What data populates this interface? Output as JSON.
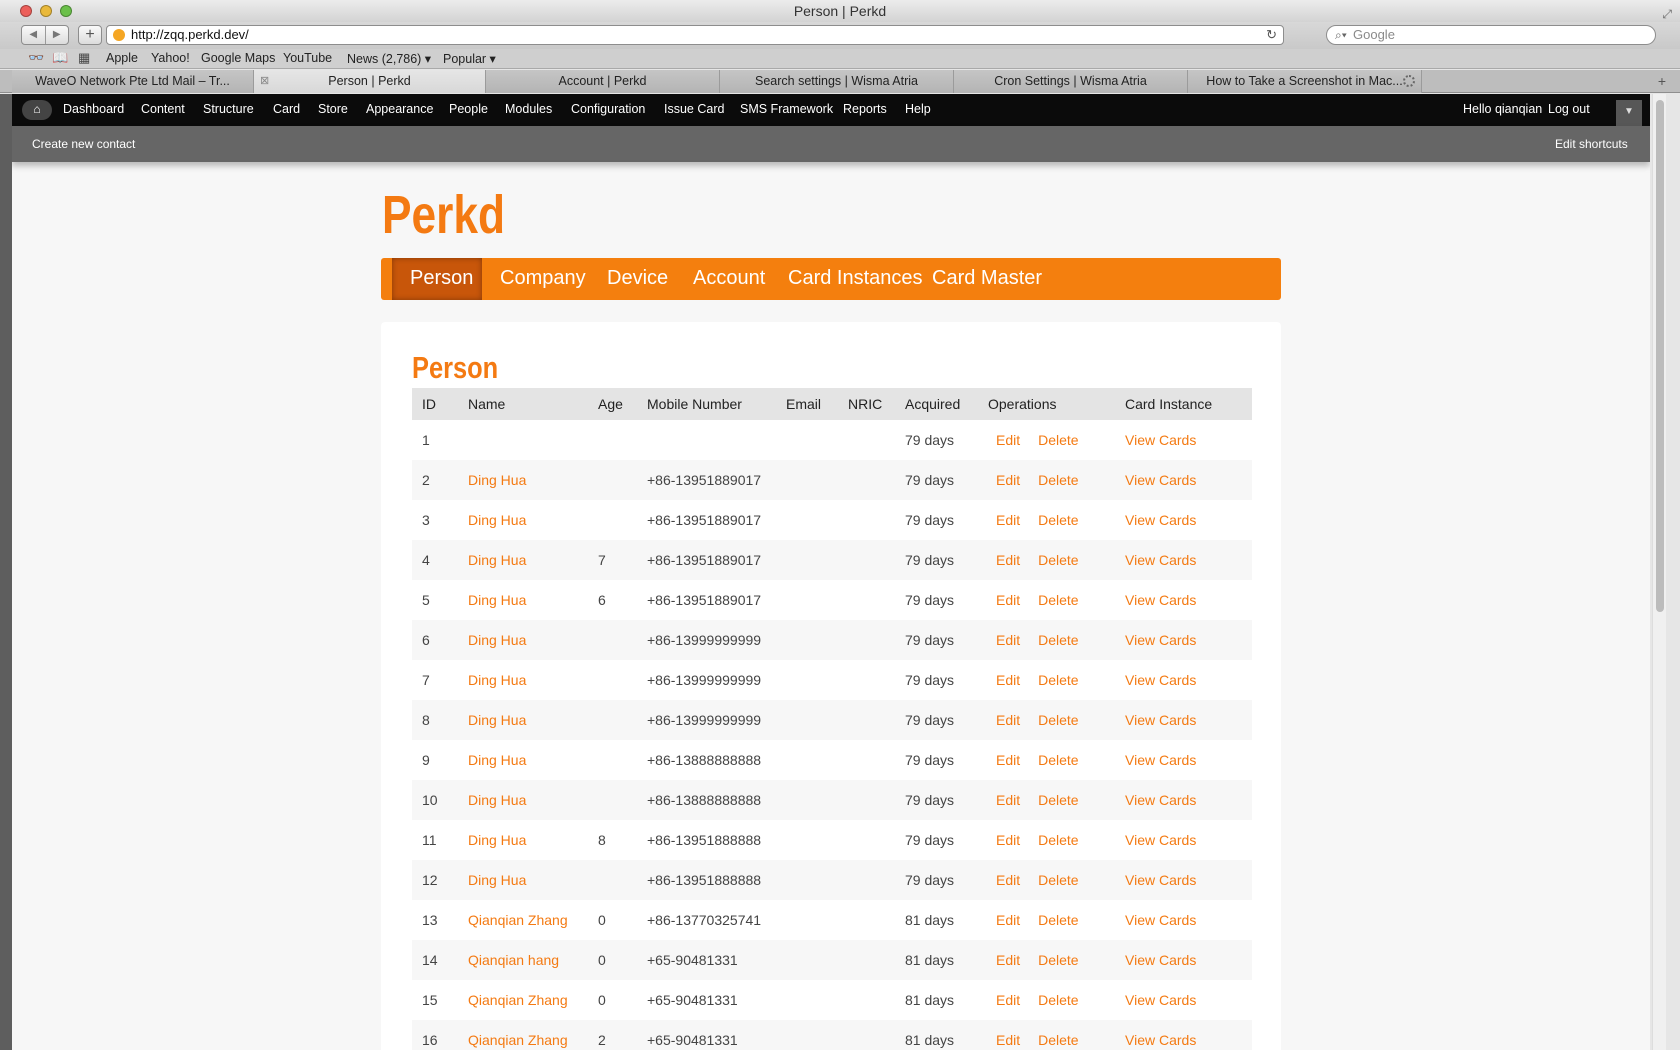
{
  "browser": {
    "window_title": "Person | Perkd",
    "url": "http://zqq.perkd.dev/",
    "search_placeholder": "Google",
    "bookmarks": [
      "Apple",
      "Yahoo!",
      "Google Maps",
      "YouTube",
      "News (2,786) ▾",
      "Popular ▾"
    ],
    "tabs": [
      {
        "label": "WaveO Network Pte Ltd Mail – Tr..."
      },
      {
        "label": "Person | Perkd"
      },
      {
        "label": "Account | Perkd"
      },
      {
        "label": "Search settings | Wisma Atria"
      },
      {
        "label": "Cron Settings | Wisma Atria"
      },
      {
        "label": "How to Take a Screenshot in Mac..."
      }
    ]
  },
  "admin_menu": {
    "items": [
      "Dashboard",
      "Content",
      "Structure",
      "Card",
      "Store",
      "Appearance",
      "People",
      "Modules",
      "Configuration",
      "Issue Card",
      "SMS Framework",
      "Reports",
      "Help"
    ],
    "greeting": "Hello qianqian",
    "logout": "Log out"
  },
  "shortcuts": {
    "create": "Create new contact",
    "edit": "Edit shortcuts"
  },
  "site": {
    "logo": "Perkd",
    "nav": [
      "Person",
      "Company",
      "Device",
      "Account",
      "Card Instances",
      "Card Master"
    ],
    "active_nav": "Person"
  },
  "content": {
    "title": "Person",
    "columns": [
      "ID",
      "Name",
      "Age",
      "Mobile Number",
      "Email",
      "NRIC",
      "Acquired",
      "Operations",
      "Card Instance"
    ],
    "op_edit": "Edit",
    "op_delete": "Delete",
    "view_cards": "View Cards",
    "rows": [
      {
        "id": "1",
        "name": "",
        "age": "",
        "mobile": "",
        "acquired": "79 days"
      },
      {
        "id": "2",
        "name": "Ding Hua",
        "age": "",
        "mobile": "+86-13951889017",
        "acquired": "79 days"
      },
      {
        "id": "3",
        "name": "Ding Hua",
        "age": "",
        "mobile": "+86-13951889017",
        "acquired": "79 days"
      },
      {
        "id": "4",
        "name": "Ding Hua",
        "age": "7",
        "mobile": "+86-13951889017",
        "acquired": "79 days"
      },
      {
        "id": "5",
        "name": "Ding Hua",
        "age": "6",
        "mobile": "+86-13951889017",
        "acquired": "79 days"
      },
      {
        "id": "6",
        "name": "Ding Hua",
        "age": "",
        "mobile": "+86-13999999999",
        "acquired": "79 days"
      },
      {
        "id": "7",
        "name": "Ding Hua",
        "age": "",
        "mobile": "+86-13999999999",
        "acquired": "79 days"
      },
      {
        "id": "8",
        "name": "Ding Hua",
        "age": "",
        "mobile": "+86-13999999999",
        "acquired": "79 days"
      },
      {
        "id": "9",
        "name": "Ding Hua",
        "age": "",
        "mobile": "+86-13888888888",
        "acquired": "79 days"
      },
      {
        "id": "10",
        "name": "Ding Hua",
        "age": "",
        "mobile": "+86-13888888888",
        "acquired": "79 days"
      },
      {
        "id": "11",
        "name": "Ding Hua",
        "age": "8",
        "mobile": "+86-13951888888",
        "acquired": "79 days"
      },
      {
        "id": "12",
        "name": "Ding Hua",
        "age": "",
        "mobile": "+86-13951888888",
        "acquired": "79 days"
      },
      {
        "id": "13",
        "name": "Qianqian Zhang",
        "age": "0",
        "mobile": "+86-13770325741",
        "acquired": "81 days"
      },
      {
        "id": "14",
        "name": "Qianqian hang",
        "age": "0",
        "mobile": "+65-90481331",
        "acquired": "81 days"
      },
      {
        "id": "15",
        "name": "Qianqian Zhang",
        "age": "0",
        "mobile": "+65-90481331",
        "acquired": "81 days"
      },
      {
        "id": "16",
        "name": "Qianqian Zhang",
        "age": "2",
        "mobile": "+65-90481331",
        "acquired": "81 days"
      }
    ]
  }
}
